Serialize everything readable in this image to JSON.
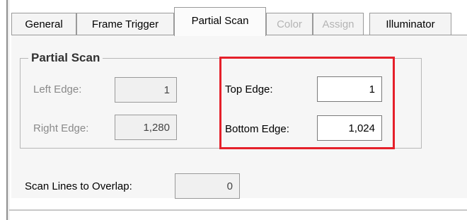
{
  "tabs": [
    {
      "label": "General",
      "state": "normal"
    },
    {
      "label": "Frame Trigger",
      "state": "normal"
    },
    {
      "label": "Partial Scan",
      "state": "selected"
    },
    {
      "label": "Color",
      "state": "disabled"
    },
    {
      "label": "Assign",
      "state": "disabled"
    },
    {
      "label": "Illuminator",
      "state": "normal"
    }
  ],
  "group": {
    "title": "Partial Scan",
    "left_edge": {
      "label": "Left Edge:",
      "value": "1"
    },
    "right_edge": {
      "label": "Right Edge:",
      "value": "1,280"
    },
    "top_edge": {
      "label": "Top Edge:",
      "value": "1"
    },
    "bottom_edge": {
      "label": "Bottom Edge:",
      "value": "1,024"
    }
  },
  "scan_lines": {
    "label": "Scan Lines to Overlap:",
    "value": "0"
  },
  "colors": {
    "highlight": "#e5202a",
    "disabled_text": "#b4b4b4"
  }
}
